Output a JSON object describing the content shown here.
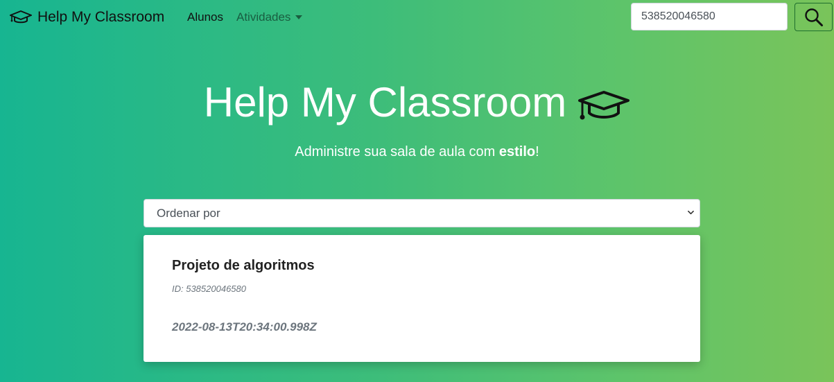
{
  "navbar": {
    "brand": "Help My Classroom",
    "brand_icon": "graduation-cap-icon",
    "links": [
      {
        "label": "Alunos"
      },
      {
        "label": "Atividades",
        "dropdown": true
      }
    ],
    "search": {
      "value": "538520046580",
      "button_icon": "search-icon",
      "button_border_color": "#1f6e2e"
    }
  },
  "hero": {
    "title": "Help My Classroom",
    "title_icon": "graduation-cap-icon",
    "subtitle_prefix": "Administre sua sala de aula com ",
    "subtitle_bold": "estilo",
    "subtitle_suffix": "!"
  },
  "sort": {
    "selected": "Ordenar por"
  },
  "card": {
    "title": "Projeto de algoritmos",
    "id_text": "ID: 538520046580",
    "date": "2022-08-13T20:34:00.998Z"
  },
  "colors": {
    "gradient_start": "#17b591",
    "gradient_end": "#7ac45a"
  }
}
